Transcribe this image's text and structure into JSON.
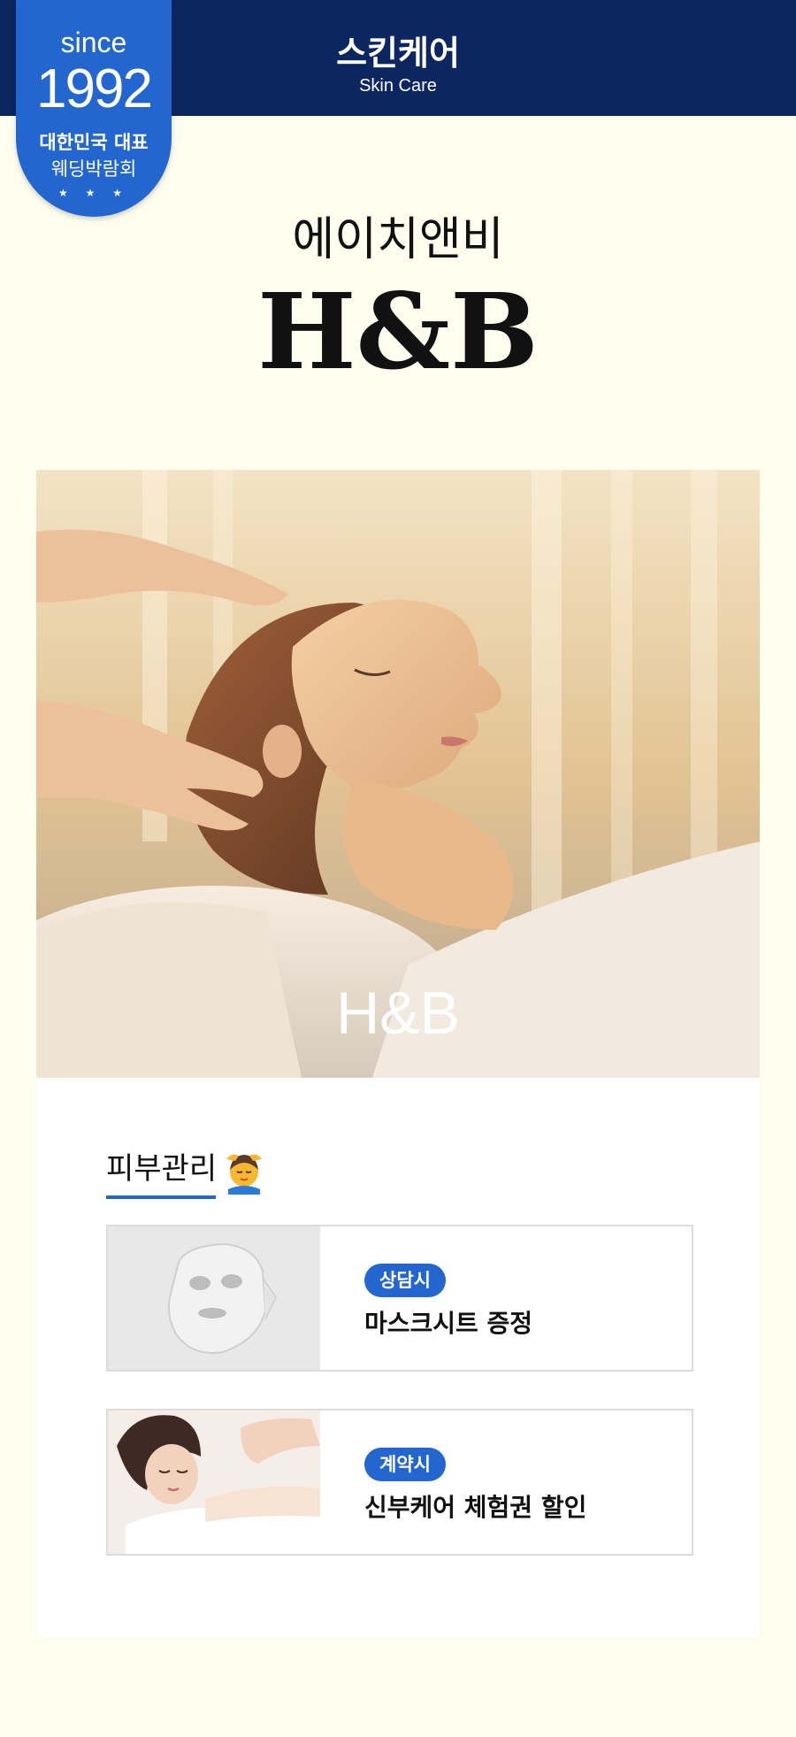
{
  "header": {
    "title": "스킨케어",
    "subtitle": "Skin Care",
    "background_color": "#0C2660"
  },
  "badge": {
    "since": "since",
    "year": "1992",
    "line1": "대한민국 대표",
    "line2": "웨딩박람회",
    "stars": "★ ★ ★",
    "color": "#2466D0"
  },
  "brand": {
    "korean_name": "에이치앤비",
    "english_name": "H&B"
  },
  "hero": {
    "label": "H&B"
  },
  "section": {
    "title": "피부관리",
    "emoji_icon": "person-getting-massage-icon",
    "accent_color": "#2466D0"
  },
  "benefits": [
    {
      "tag": "상담시",
      "text": "마스크시트 증정",
      "image_icon": "face-mask-sheet-image"
    },
    {
      "tag": "계약시",
      "text": "신부케어 체험권 할인",
      "image_icon": "bridal-care-massage-image"
    }
  ],
  "page_background": "#FEFEEE"
}
